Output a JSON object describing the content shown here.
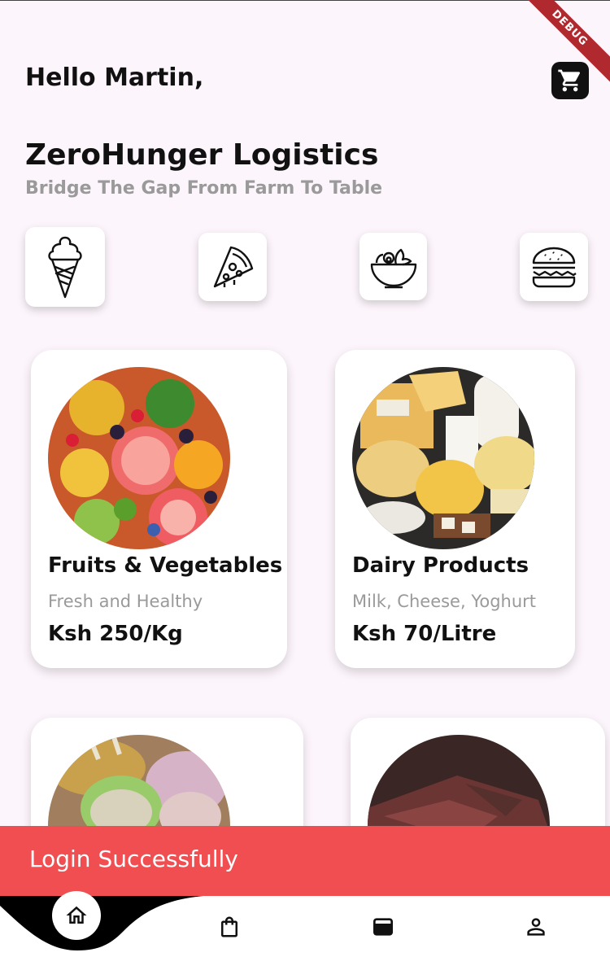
{
  "debug_banner": "DEBUG",
  "header": {
    "greeting": "Hello Martin,",
    "cart_icon": "cart-icon"
  },
  "hero": {
    "title": "ZeroHunger Logistics",
    "subtitle": "Bridge The Gap From Farm To Table"
  },
  "categories": [
    {
      "icon": "ice-cream-icon"
    },
    {
      "icon": "pizza-icon"
    },
    {
      "icon": "salad-bowl-icon"
    },
    {
      "icon": "burger-icon"
    }
  ],
  "products": [
    {
      "name": "Fruits & Vegetables",
      "description": "Fresh and Healthy",
      "price": "Ksh 250/Kg"
    },
    {
      "name": "Dairy Products",
      "description": "Milk, Cheese, Yoghurt",
      "price": "Ksh 70/Litre"
    }
  ],
  "snackbar": {
    "message": "Login Successfully"
  },
  "bottom_nav": {
    "items": [
      {
        "icon": "home-icon"
      },
      {
        "icon": "shopping-bag-icon"
      },
      {
        "icon": "wallet-icon"
      },
      {
        "icon": "profile-icon"
      }
    ]
  },
  "colors": {
    "background": "#fcf5fb",
    "snackbar": "#f04e51",
    "nav_curve": "#000000"
  }
}
